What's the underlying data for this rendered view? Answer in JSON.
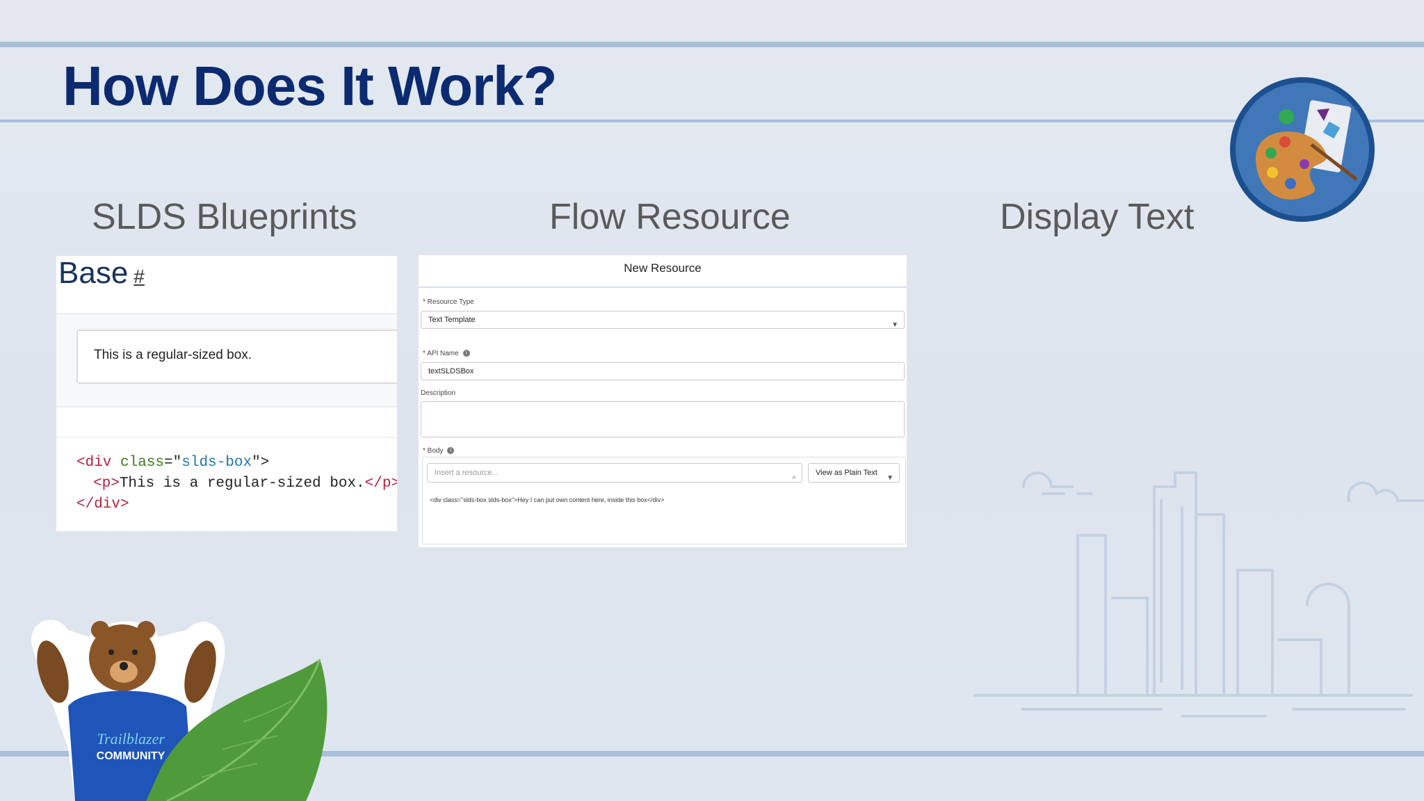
{
  "slide": {
    "title": "How Does It Work?",
    "columns": [
      "SLDS Blueprints",
      "Flow Resource",
      "Display Text"
    ]
  },
  "slds_panel": {
    "heading": "Base",
    "anchor": "#",
    "example_text": "This is a regular-sized box.",
    "code": {
      "line1_open": "<div ",
      "line1_attr": "class",
      "line1_eq": "=\"",
      "line1_val": "slds-box",
      "line1_close": "\">",
      "line2_open": "<p>",
      "line2_text": "This is a regular-sized box.",
      "line2_close": "</p>",
      "line3": "</div>"
    }
  },
  "flow_panel": {
    "header": "New Resource",
    "resource_type_label": "* Resource Type",
    "resource_type_value": "Text Template",
    "api_name_label": "* API Name",
    "api_name_value": "textSLDSBox",
    "description_label": "Description",
    "body_label": "* Body",
    "resource_search_placeholder": "Insert a resource...",
    "view_mode": "View as Plain Text",
    "body_text": "<div class=\"slds-box slds-box\">Hey I can put own content here, inside this box</div>"
  },
  "bear_shirt": {
    "line1": "Trailblazer",
    "line2": "COMMUNITY"
  },
  "colors": {
    "title": "#0b2a70",
    "column_heading": "#5a5a5a",
    "rule_lines": "#a9bedb"
  }
}
